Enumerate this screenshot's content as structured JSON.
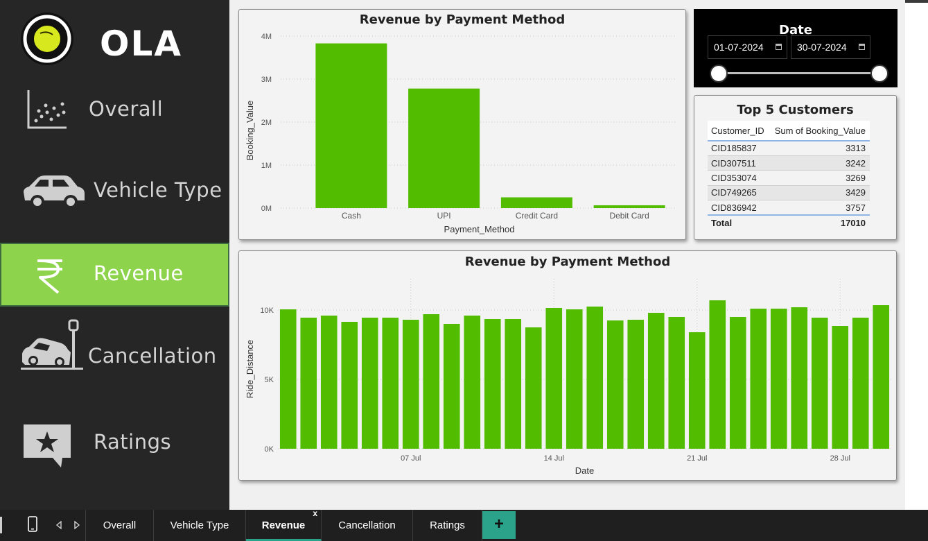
{
  "brand": {
    "logo_text": "OLA"
  },
  "sidebar": {
    "items": [
      {
        "label": "Overall",
        "icon": "scatter-icon"
      },
      {
        "label": "Vehicle Type",
        "icon": "car-icon"
      },
      {
        "label": "Revenue",
        "icon": "rupee-icon",
        "active": true
      },
      {
        "label": "Cancellation",
        "icon": "crash-icon"
      },
      {
        "label": "Ratings",
        "icon": "star-chat-icon"
      }
    ]
  },
  "colors": {
    "accent": "#8ed34c",
    "bar": "#52bd00",
    "sidebar": "#262626",
    "tab_add": "#2aa38a"
  },
  "date_slicer": {
    "title": "Date",
    "start": "01-07-2024",
    "end": "30-07-2024"
  },
  "top_customers": {
    "title": "Top 5 Customers",
    "columns": [
      "Customer_ID",
      "Sum of Booking_Value"
    ],
    "rows": [
      [
        "CID185837",
        "3313"
      ],
      [
        "CID307511",
        "3242"
      ],
      [
        "CID353074",
        "3269"
      ],
      [
        "CID749265",
        "3429"
      ],
      [
        "CID836942",
        "3757"
      ]
    ],
    "total_label": "Total",
    "total_value": "17010"
  },
  "chart_data": [
    {
      "type": "bar",
      "title": "Revenue by Payment Method",
      "xlabel": "Payment_Method",
      "ylabel": "Booking_Value",
      "categories": [
        "Cash",
        "UPI",
        "Credit Card",
        "Debit Card"
      ],
      "values": [
        3830000,
        2780000,
        250000,
        65000
      ],
      "ylim": [
        0,
        4000000
      ],
      "yticks": [
        "0M",
        "1M",
        "2M",
        "3M",
        "4M"
      ],
      "grid": true
    },
    {
      "type": "bar",
      "title": "Revenue by Payment Method",
      "xlabel": "Date",
      "ylabel": "Ride_Distance",
      "x": [
        "2024-07-01",
        "2024-07-02",
        "2024-07-03",
        "2024-07-04",
        "2024-07-05",
        "2024-07-06",
        "2024-07-07",
        "2024-07-08",
        "2024-07-09",
        "2024-07-10",
        "2024-07-11",
        "2024-07-12",
        "2024-07-13",
        "2024-07-14",
        "2024-07-15",
        "2024-07-16",
        "2024-07-17",
        "2024-07-18",
        "2024-07-19",
        "2024-07-20",
        "2024-07-21",
        "2024-07-22",
        "2024-07-23",
        "2024-07-24",
        "2024-07-25",
        "2024-07-26",
        "2024-07-27",
        "2024-07-28",
        "2024-07-29",
        "2024-07-30"
      ],
      "values": [
        10050,
        9450,
        9600,
        9150,
        9450,
        9450,
        9300,
        9700,
        9000,
        9600,
        9350,
        9350,
        8750,
        10150,
        10050,
        10250,
        9250,
        9300,
        9800,
        9500,
        8400,
        10700,
        9500,
        10100,
        10100,
        10200,
        9450,
        8850,
        9450,
        10350
      ],
      "ylim": [
        0,
        12000
      ],
      "yticks": [
        "0K",
        "5K",
        "10K"
      ],
      "xtick_labels": [
        "07 Jul",
        "14 Jul",
        "21 Jul",
        "28 Jul"
      ],
      "grid": true
    }
  ],
  "tabs": [
    {
      "label": "Overall"
    },
    {
      "label": "Vehicle Type"
    },
    {
      "label": "Revenue",
      "active": true,
      "close": "x"
    },
    {
      "label": "Cancellation"
    },
    {
      "label": "Ratings"
    }
  ],
  "tab_add_label": "+"
}
